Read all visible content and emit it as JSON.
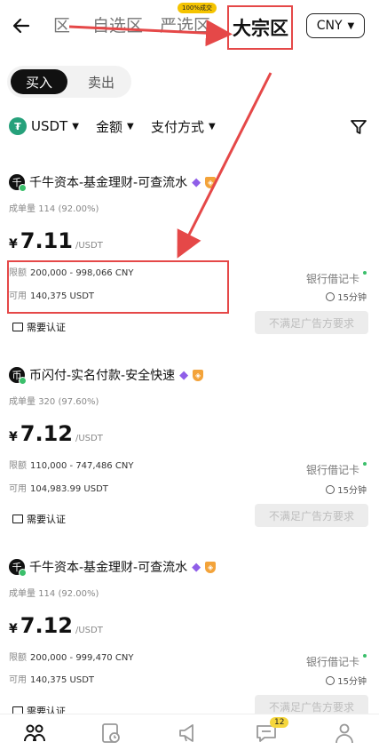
{
  "header": {
    "tabs": [
      {
        "label": "区"
      },
      {
        "label": "自选区"
      },
      {
        "label": "严选区",
        "badge": "100%成交"
      },
      {
        "label": "大宗区",
        "active": true
      }
    ],
    "currency": "CNY"
  },
  "toggle": {
    "buy": "买入",
    "sell": "卖出"
  },
  "filters": {
    "coin": "USDT",
    "amount": "金额",
    "payment": "支付方式"
  },
  "listings": [
    {
      "merchant": "千牛资本-基金理财-可查流水",
      "avatar": "千",
      "stat_label": "成单量",
      "stat_value": "114 (92.00%)",
      "currency_symbol": "¥",
      "price": "7.11",
      "unit": "/USDT",
      "limit_label": "限额",
      "limit": "200,000 - 998,066 CNY",
      "avail_label": "可用",
      "avail": "140,375 USDT",
      "pay": "银行借记卡",
      "time": "15分钟",
      "button": "不满足广告方要求",
      "verify": "需要认证"
    },
    {
      "merchant": "币闪付-实名付款-安全快速",
      "avatar": "币",
      "stat_label": "成单量",
      "stat_value": "320 (97.60%)",
      "currency_symbol": "¥",
      "price": "7.12",
      "unit": "/USDT",
      "limit_label": "限额",
      "limit": "110,000 - 747,486 CNY",
      "avail_label": "可用",
      "avail": "104,983.99 USDT",
      "pay": "银行借记卡",
      "time": "15分钟",
      "button": "不满足广告方要求",
      "verify": "需要认证"
    },
    {
      "merchant": "千牛资本-基金理财-可查流水",
      "avatar": "千",
      "stat_label": "成单量",
      "stat_value": "114 (92.00%)",
      "currency_symbol": "¥",
      "price": "7.12",
      "unit": "/USDT",
      "limit_label": "限额",
      "limit": "200,000 - 999,470 CNY",
      "avail_label": "可用",
      "avail": "140,375 USDT",
      "pay": "银行借记卡",
      "time": "15分钟",
      "button": "不满足广告方要求",
      "verify": "需要认证"
    }
  ],
  "bottom_nav": {
    "messages_badge": "12"
  },
  "colors": {
    "highlight": "#e54848",
    "accent": "#f5c400",
    "online": "#3bbf6b",
    "usdt": "#26a17b"
  }
}
